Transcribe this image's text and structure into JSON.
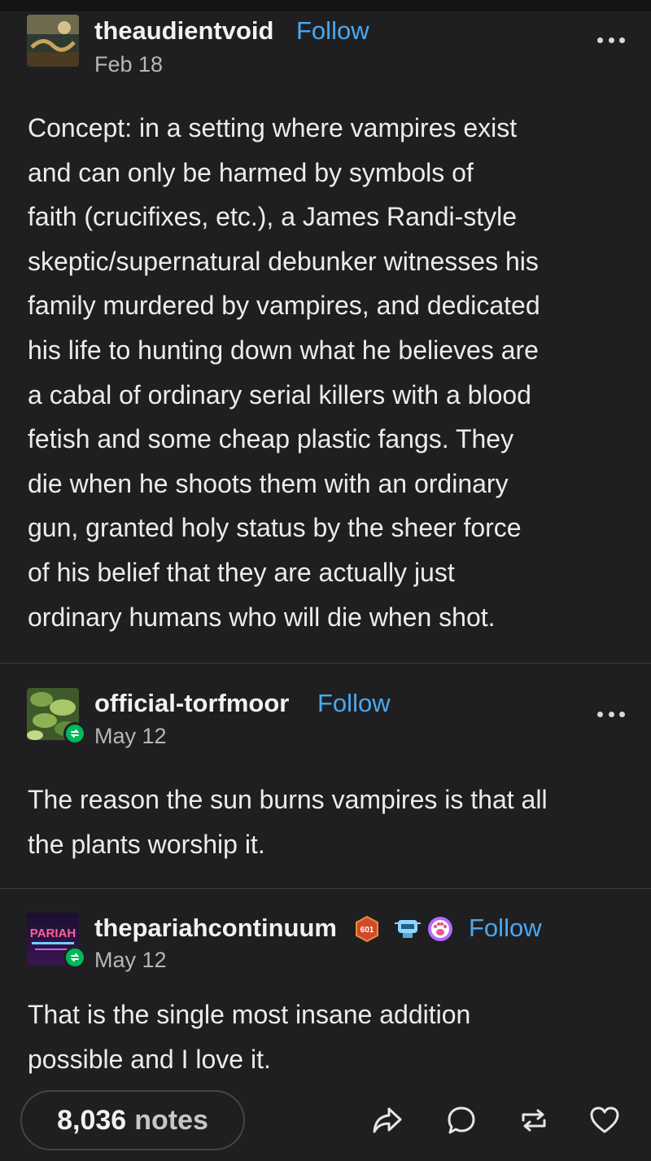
{
  "posts": [
    {
      "username": "theaudientvoid",
      "follow_label": "Follow",
      "date": "Feb 18",
      "lines": [
        "Concept: in a setting where vampires exist",
        "and can only be harmed by symbols of",
        "faith (crucifixes, etc.), a James Randi-style",
        "skeptic/supernatural debunker witnesses his",
        "family murdered by vampires, and dedicated",
        "his life to hunting down what he believes are",
        "a cabal of ordinary serial killers with a blood",
        "fetish and some cheap plastic fangs. They",
        "die when he shoots them with an ordinary",
        "gun, granted holy status by the sheer force",
        "of his belief that they are actually just",
        "ordinary humans who will die when shot."
      ]
    },
    {
      "username": "official-torfmoor",
      "follow_label": "Follow",
      "date": "May 12",
      "lines": [
        "The reason the sun burns vampires is that all",
        "the plants worship it."
      ]
    },
    {
      "username": "thepariahcontinuum",
      "follow_label": "Follow",
      "date": "May 12",
      "badge_number": "601",
      "avatar_text": "PARIAH",
      "lines": [
        "That is the single most insane addition",
        "possible and I love it."
      ]
    }
  ],
  "footer": {
    "notes_count": "8,036",
    "notes_label": "notes",
    "actions": [
      "share-icon",
      "reply-icon",
      "reblog-icon",
      "like-icon"
    ]
  },
  "colors": {
    "background": "#1f1f21",
    "follow": "#4aa8f0",
    "reblog_badge": "#00b85c"
  }
}
